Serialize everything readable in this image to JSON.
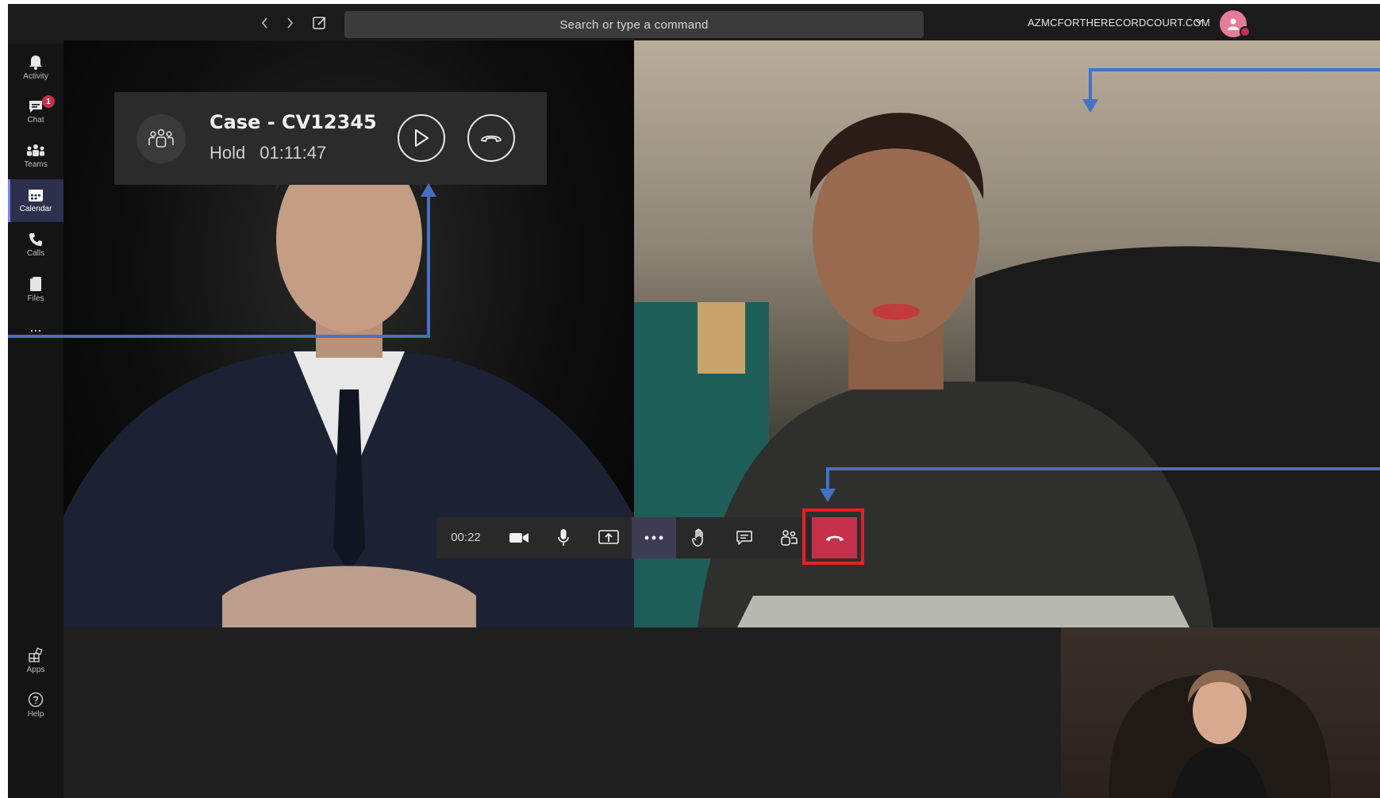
{
  "topbar": {
    "search_placeholder": "Search or type a command",
    "org_name": "AZMCFORTHERECORDCOURT.COM"
  },
  "rail": {
    "items": [
      {
        "label": "Activity",
        "icon": "bell-icon"
      },
      {
        "label": "Chat",
        "icon": "chat-icon",
        "badge": "1"
      },
      {
        "label": "Teams",
        "icon": "teams-icon"
      },
      {
        "label": "Calendar",
        "icon": "calendar-icon",
        "active": true
      },
      {
        "label": "Calls",
        "icon": "phone-icon"
      },
      {
        "label": "Files",
        "icon": "file-icon"
      },
      {
        "label": "...",
        "icon": "more-icon"
      }
    ],
    "bottom_items": [
      {
        "label": "Apps",
        "icon": "apps-icon"
      },
      {
        "label": "Help",
        "icon": "help-icon"
      }
    ]
  },
  "hold_card": {
    "title": "Case - CV12345",
    "status": "Hold",
    "elapsed": "01:11:47"
  },
  "controls": {
    "timer": "00:22"
  },
  "colors": {
    "accent": "#7b83eb",
    "hangup": "#c4314b",
    "highlight": "#e81e25",
    "annotation": "#4472c4"
  }
}
